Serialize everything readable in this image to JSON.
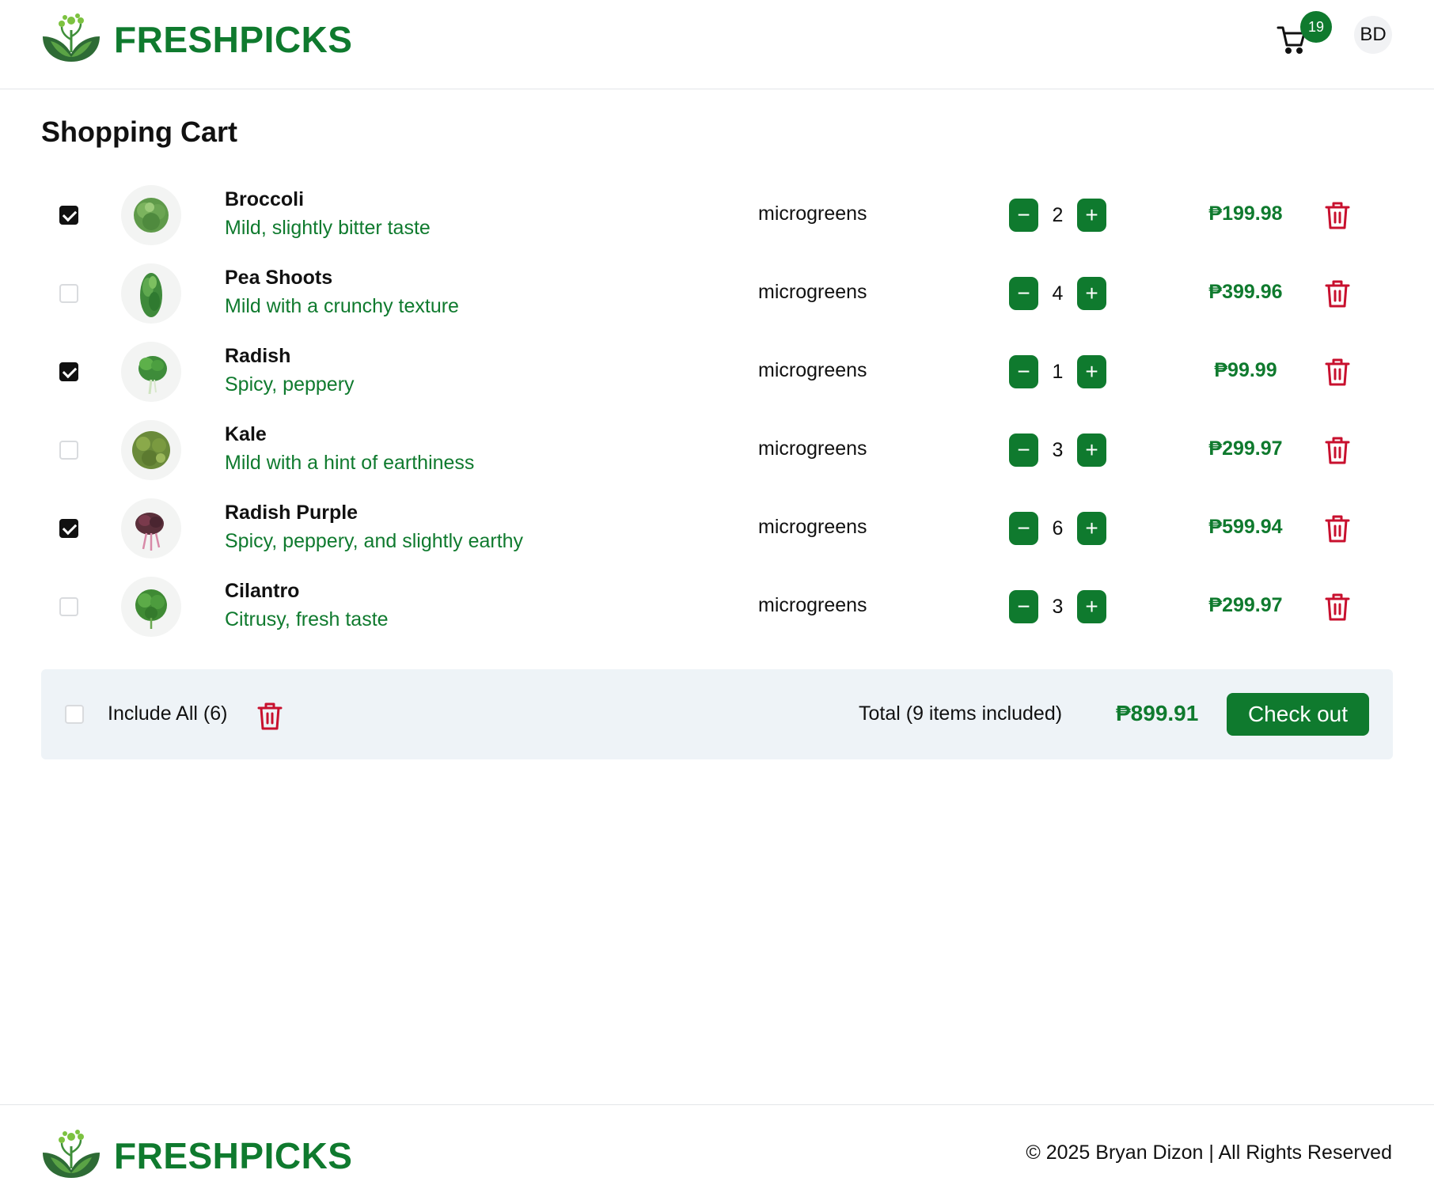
{
  "header": {
    "brand": "FRESHPICKS",
    "cart_count": "19",
    "avatar_initials": "BD"
  },
  "page": {
    "title": "Shopping Cart"
  },
  "items": [
    {
      "checked": true,
      "name": "Broccoli",
      "desc": "Mild, slightly bitter taste",
      "category": "microgreens",
      "qty": "2",
      "price": "₱199.98"
    },
    {
      "checked": false,
      "name": "Pea Shoots",
      "desc": "Mild with a crunchy texture",
      "category": "microgreens",
      "qty": "4",
      "price": "₱399.96"
    },
    {
      "checked": true,
      "name": "Radish",
      "desc": "Spicy, peppery",
      "category": "microgreens",
      "qty": "1",
      "price": "₱99.99"
    },
    {
      "checked": false,
      "name": "Kale",
      "desc": "Mild with a hint of earthiness",
      "category": "microgreens",
      "qty": "3",
      "price": "₱299.97"
    },
    {
      "checked": true,
      "name": "Radish Purple",
      "desc": "Spicy, peppery, and slightly earthy",
      "category": "microgreens",
      "qty": "6",
      "price": "₱599.94"
    },
    {
      "checked": false,
      "name": "Cilantro",
      "desc": "Citrusy, fresh taste",
      "category": "microgreens",
      "qty": "3",
      "price": "₱299.97"
    }
  ],
  "summary": {
    "include_all_label": "Include All (6)",
    "total_label": "Total (9 items included)",
    "total_value": "₱899.91",
    "checkout_label": "Check out"
  },
  "footer": {
    "brand": "FRESHPICKS",
    "copyright": "© 2025 Bryan Dizon | All Rights Reserved"
  },
  "colors": {
    "brand_green": "#0f7a2e",
    "delete_red": "#c8102e",
    "summary_bg": "#eef3f7"
  },
  "icons": {
    "logo": "leaf-sprout-icon",
    "cart": "cart-icon",
    "minus": "minus-icon",
    "plus": "plus-icon",
    "delete": "trash-icon"
  }
}
